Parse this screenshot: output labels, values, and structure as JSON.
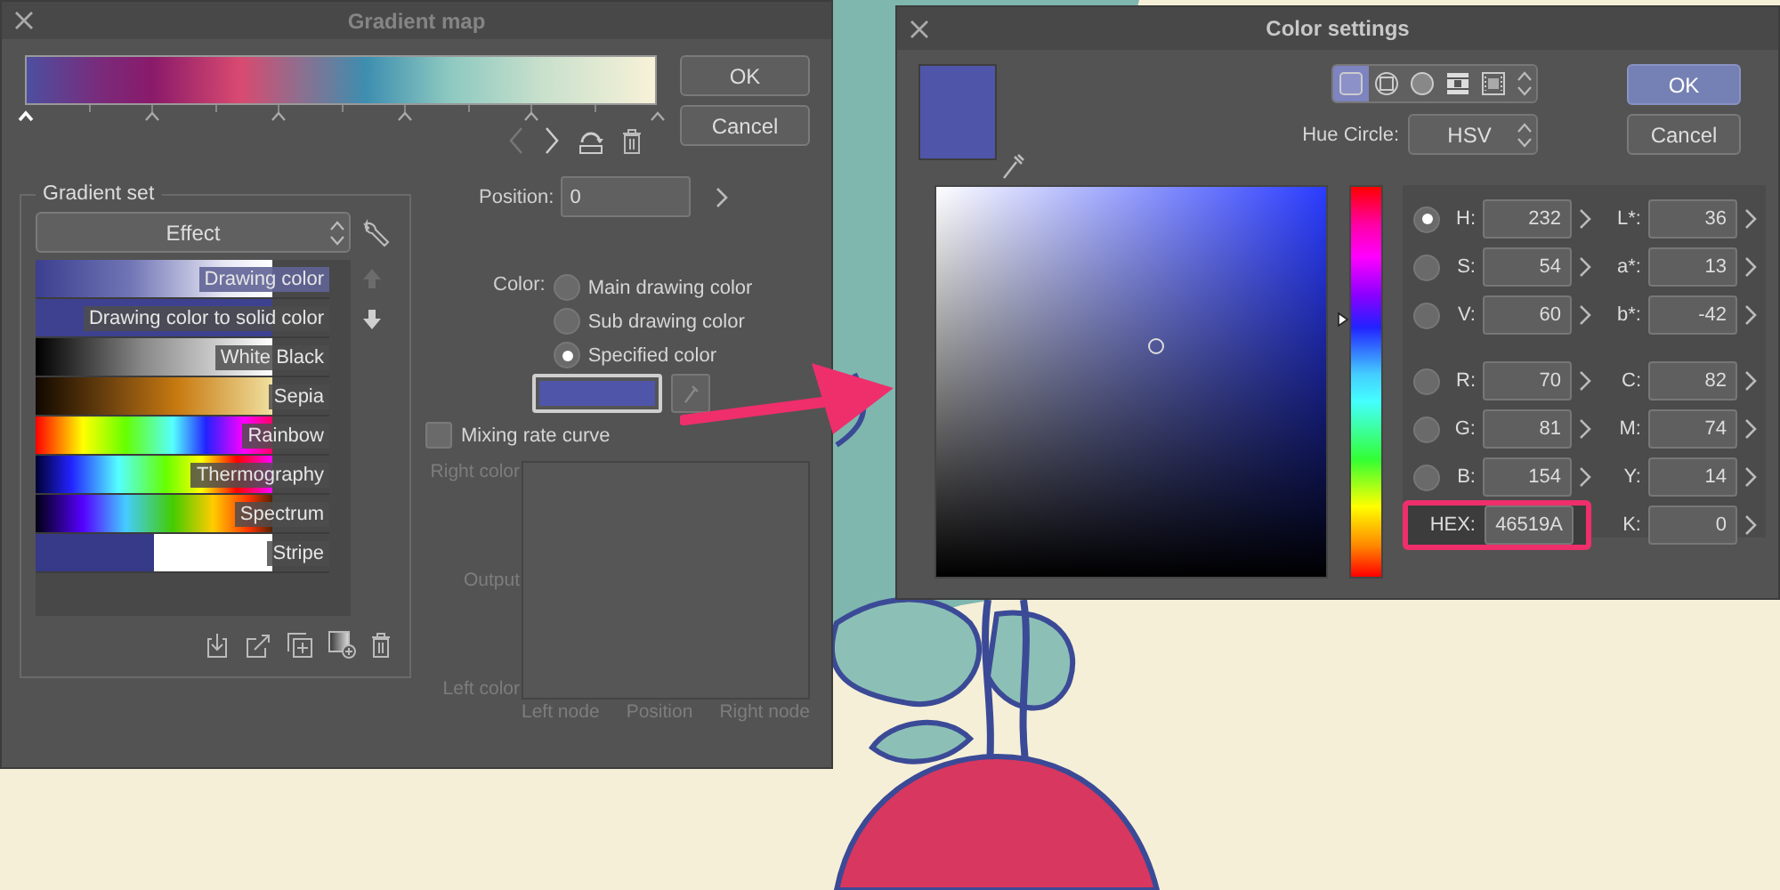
{
  "gradient_map": {
    "title": "Gradient map",
    "nodes": [
      {
        "selected": true
      },
      {
        "selected": false
      },
      {
        "selected": false
      },
      {
        "selected": false
      },
      {
        "selected": false
      },
      {
        "selected": false
      }
    ],
    "buttons": [
      "OK",
      "Cancel"
    ],
    "gradient_set": {
      "title": "Gradient set",
      "dropdown": "Effect",
      "items": [
        {
          "label": "Drawing color",
          "selected": true
        },
        {
          "label": "Drawing color to solid color",
          "selected": false
        },
        {
          "label": "White Black",
          "selected": false
        },
        {
          "label": "Sepia",
          "selected": false
        },
        {
          "label": "Rainbow",
          "selected": false
        },
        {
          "label": "Thermography",
          "selected": false
        },
        {
          "label": "Spectrum",
          "selected": false
        },
        {
          "label": "Stripe",
          "selected": false
        }
      ]
    },
    "position": {
      "label": "Position:",
      "value": "0"
    },
    "color": {
      "label": "Color:",
      "options": [
        {
          "label": "Main drawing color",
          "selected": false
        },
        {
          "label": "Sub drawing color",
          "selected": false
        },
        {
          "label": "Specified color",
          "selected": true
        }
      ]
    },
    "mixing_rate_curve": {
      "label": "Mixing rate curve",
      "checked": false
    },
    "graph": {
      "y_labels": [
        "Right color",
        "Output",
        "Left color"
      ],
      "x_labels": [
        "Left node",
        "Position",
        "Right node"
      ]
    }
  },
  "color_settings": {
    "title": "Color settings",
    "view_modes": [
      {
        "kind": "square",
        "selected": true
      },
      {
        "kind": "framed-circle",
        "selected": false
      },
      {
        "kind": "circle",
        "selected": false
      },
      {
        "kind": "grid",
        "selected": false
      },
      {
        "kind": "film",
        "selected": false
      }
    ],
    "hue_circle": {
      "label": "Hue Circle:",
      "value": "HSV"
    },
    "buttons": [
      "OK",
      "Cancel"
    ],
    "hue_slider": {
      "level": 0.66
    },
    "hsv_rgb": [
      {
        "label": "H:",
        "value": "232",
        "selected": true
      },
      {
        "label": "S:",
        "value": "54",
        "selected": false
      },
      {
        "label": "V:",
        "value": "60",
        "selected": false
      },
      {
        "label": "R:",
        "value": "70",
        "selected": false
      },
      {
        "label": "G:",
        "value": "81",
        "selected": false
      },
      {
        "label": "B:",
        "value": "154",
        "selected": false
      }
    ],
    "hex": {
      "label": "HEX:",
      "value": "46519A",
      "highlighted": true
    },
    "lab_cmyk": [
      {
        "label": "L*:",
        "value": "36"
      },
      {
        "label": "a*:",
        "value": "13"
      },
      {
        "label": "b*:",
        "value": "-42"
      },
      {
        "label": "C:",
        "value": "82"
      },
      {
        "label": "M:",
        "value": "74"
      },
      {
        "label": "Y:",
        "value": "14"
      },
      {
        "label": "K:",
        "value": "0"
      }
    ]
  }
}
